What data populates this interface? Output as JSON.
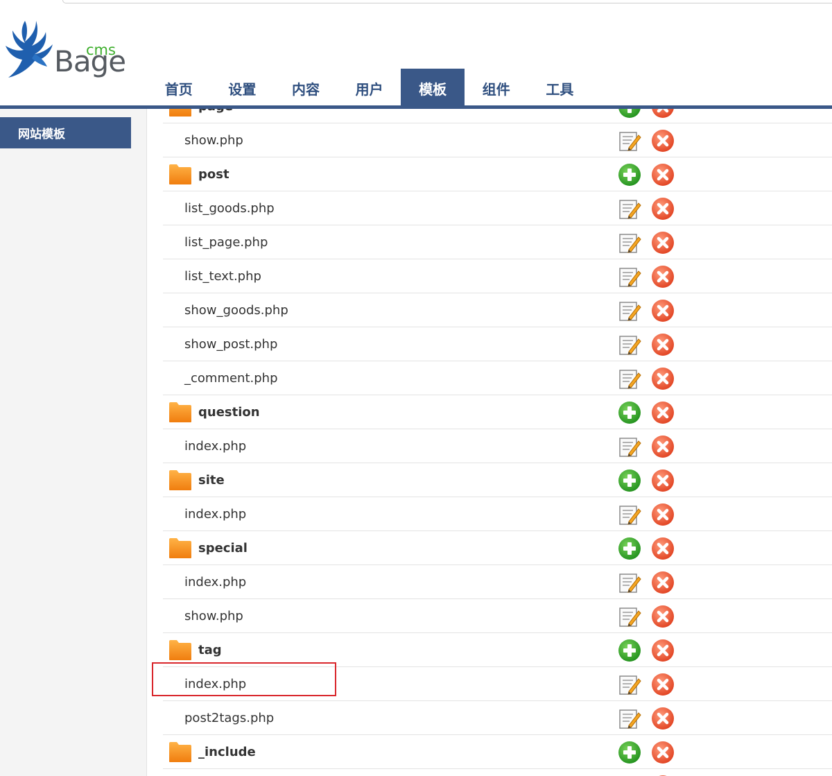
{
  "app": {
    "logo_text": "Bage",
    "logo_sub": "cms"
  },
  "nav": {
    "tabs": [
      {
        "label": "首页"
      },
      {
        "label": "设置"
      },
      {
        "label": "内容"
      },
      {
        "label": "用户"
      },
      {
        "label": "模板",
        "active": true
      },
      {
        "label": "组件"
      },
      {
        "label": "工具"
      }
    ]
  },
  "sidebar": {
    "items": [
      {
        "label": "网站模板"
      }
    ]
  },
  "templates": [
    {
      "type": "dir",
      "name": "page"
    },
    {
      "type": "file",
      "name": "show.php"
    },
    {
      "type": "dir",
      "name": "post"
    },
    {
      "type": "file",
      "name": "list_goods.php"
    },
    {
      "type": "file",
      "name": "list_page.php"
    },
    {
      "type": "file",
      "name": "list_text.php"
    },
    {
      "type": "file",
      "name": "show_goods.php"
    },
    {
      "type": "file",
      "name": "show_post.php"
    },
    {
      "type": "file",
      "name": "_comment.php"
    },
    {
      "type": "dir",
      "name": "question"
    },
    {
      "type": "file",
      "name": "index.php"
    },
    {
      "type": "dir",
      "name": "site"
    },
    {
      "type": "file",
      "name": "index.php"
    },
    {
      "type": "dir",
      "name": "special"
    },
    {
      "type": "file",
      "name": "index.php"
    },
    {
      "type": "file",
      "name": "show.php"
    },
    {
      "type": "dir",
      "name": "tag"
    },
    {
      "type": "file",
      "name": "index.php"
    },
    {
      "type": "file",
      "name": "post2tags.php"
    },
    {
      "type": "dir",
      "name": "_include"
    },
    {
      "type": "file",
      "name": ""
    }
  ],
  "icons": {
    "folder": "folder-icon",
    "add": "add-icon",
    "edit": "edit-icon",
    "delete": "delete-icon"
  },
  "colors": {
    "accent": "#3a5888",
    "nav_text": "#2f4f7f",
    "add_green": "#2ea52a",
    "delete_red": "#ef5a3a",
    "folder_orange": "#f7931e",
    "logo_green": "#3cae2b",
    "highlight": "#d9262b"
  }
}
